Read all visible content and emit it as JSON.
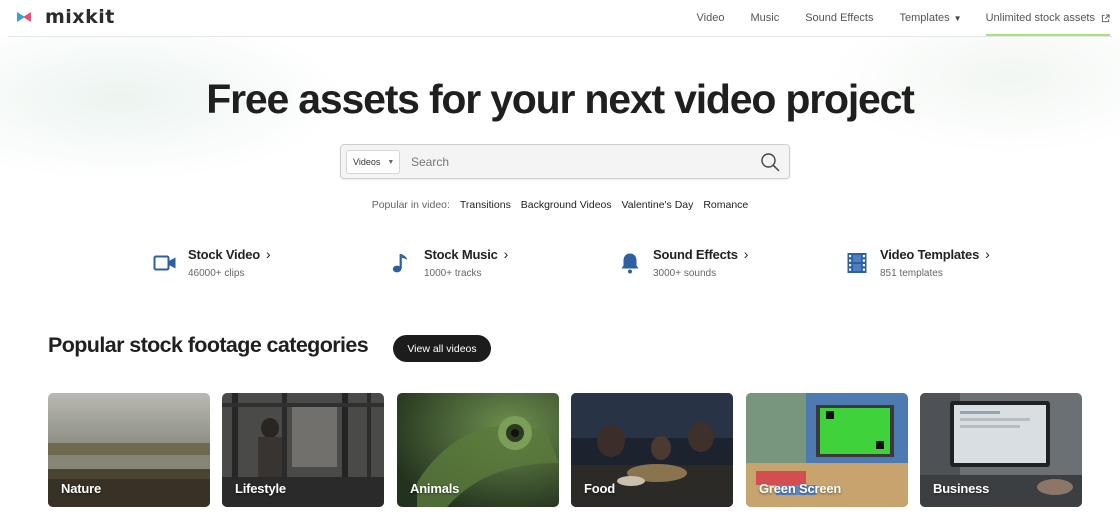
{
  "brand": {
    "logo_text": "mixkit",
    "accent_color": "#a6e37a",
    "logo_colors": [
      "#3aa0d8",
      "#e8527a"
    ]
  },
  "nav": {
    "items": [
      {
        "label": "Video"
      },
      {
        "label": "Music"
      },
      {
        "label": "Sound Effects"
      },
      {
        "label": "Templates",
        "icon": "caret-down-icon"
      },
      {
        "label": "Unlimited stock assets",
        "icon": "external-link-icon"
      }
    ]
  },
  "hero": {
    "title": "Free assets for your next video project"
  },
  "search": {
    "category_selected": "Videos",
    "placeholder": "Search",
    "value": "",
    "icon": "search-icon"
  },
  "popular": {
    "label": "Popular in video:",
    "tags": [
      "Transitions",
      "Background Videos",
      "Valentine's Day",
      "Romance"
    ]
  },
  "asset_types": [
    {
      "title": "Stock Video",
      "subtitle": "46000+ clips",
      "icon": "video-camera-icon"
    },
    {
      "title": "Stock Music",
      "subtitle": "1000+ tracks",
      "icon": "music-note-icon"
    },
    {
      "title": "Sound Effects",
      "subtitle": "3000+ sounds",
      "icon": "bell-icon"
    },
    {
      "title": "Video Templates",
      "subtitle": "851 templates",
      "icon": "film-strip-icon"
    }
  ],
  "asset_icon_color": "#2d5fa3",
  "categories": {
    "heading": "Popular stock footage categories",
    "button_label": "View all videos",
    "items": [
      {
        "label": "Nature"
      },
      {
        "label": "Lifestyle"
      },
      {
        "label": "Animals"
      },
      {
        "label": "Food"
      },
      {
        "label": "Green Screen"
      },
      {
        "label": "Business"
      }
    ]
  }
}
